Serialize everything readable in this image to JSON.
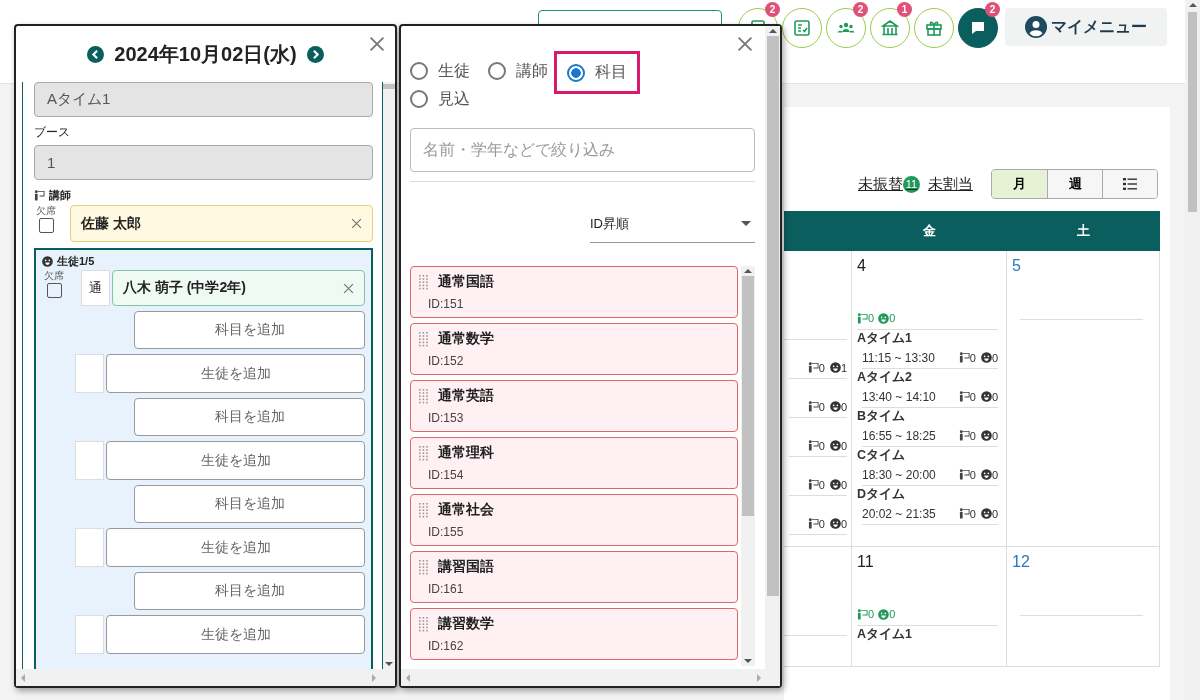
{
  "header": {
    "icon_buttons": [
      {
        "kind": "document",
        "badge": "2"
      },
      {
        "kind": "checklist"
      },
      {
        "kind": "group",
        "badge": "2"
      },
      {
        "kind": "building",
        "badge": "1"
      },
      {
        "kind": "gift"
      },
      {
        "kind": "chat",
        "badge": "2"
      }
    ],
    "my_menu": {
      "label": "マイメニュー"
    }
  },
  "calendar": {
    "links": [
      {
        "label": "未振替",
        "badge": "11"
      },
      {
        "label": "未割当"
      }
    ],
    "views": [
      {
        "kind": "text",
        "label": "月",
        "selected": true
      },
      {
        "kind": "text",
        "label": "週",
        "selected": false
      },
      {
        "kind": "list",
        "selected": false
      }
    ],
    "weekdays": [
      "金",
      "土"
    ],
    "weeks": [
      {
        "partial_slots": [
          {
            "teachers": "0",
            "students": "1"
          },
          {
            "teachers": "0",
            "students": "0"
          },
          {
            "teachers": "0",
            "students": "0"
          },
          {
            "teachers": "0",
            "students": "0"
          },
          {
            "teachers": "0",
            "students": "0"
          }
        ],
        "friday": {
          "day": "4",
          "teachers": "0",
          "students": "0",
          "slots": [
            {
              "name": "Aタイム1",
              "time": "11:15 ~ 13:30",
              "teachers": "0",
              "students": "0"
            },
            {
              "name": "Aタイム2",
              "time": "13:40 ~ 14:10",
              "teachers": "0",
              "students": "0"
            },
            {
              "name": "Bタイム",
              "time": "16:55 ~ 18:25",
              "teachers": "0",
              "students": "0"
            },
            {
              "name": "Cタイム",
              "time": "18:30 ~ 20:00",
              "teachers": "0",
              "students": "0"
            },
            {
              "name": "Dタイム",
              "time": "20:02 ~ 21:35",
              "teachers": "0",
              "students": "0"
            }
          ]
        },
        "saturday": {
          "day": "5"
        }
      },
      {
        "friday": {
          "day": "11",
          "teachers": "0",
          "students": "0",
          "slots": [
            {
              "name": "Aタイム1"
            }
          ]
        },
        "saturday": {
          "day": "12"
        }
      }
    ]
  },
  "lesson_panel": {
    "title": "2024年10月02日(水)",
    "time_field": "Aタイム1",
    "booth_label": "ブース",
    "booth_field": "1",
    "teacher_label": "講師",
    "teacher": {
      "absent_label": "欠席",
      "absent": false,
      "name": "佐藤 太郎"
    },
    "students_label": "生徒1/5",
    "entries": [
      {
        "kind": "student",
        "absent_label": "欠席",
        "absent": false,
        "tag": "通",
        "name": "八木 萌子 (中学2年)"
      },
      {
        "kind": "add-subject",
        "label": "科目を追加"
      },
      {
        "kind": "add-student",
        "label": "生徒を追加"
      },
      {
        "kind": "add-subject",
        "label": "科目を追加"
      },
      {
        "kind": "add-student",
        "label": "生徒を追加"
      },
      {
        "kind": "add-subject",
        "label": "科目を追加"
      },
      {
        "kind": "add-student",
        "label": "生徒を追加"
      },
      {
        "kind": "add-subject",
        "label": "科目を追加"
      },
      {
        "kind": "add-student",
        "label": "生徒を追加"
      }
    ]
  },
  "search_panel": {
    "modes": [
      {
        "label": "生徒",
        "selected": false,
        "highlighted": false
      },
      {
        "label": "講師",
        "selected": false,
        "highlighted": false
      },
      {
        "label": "科目",
        "selected": true,
        "highlighted": true
      },
      {
        "label": "見込",
        "selected": false,
        "highlighted": false
      }
    ],
    "filter": {
      "placeholder": "名前・学年などで絞り込み"
    },
    "sort": {
      "value": "ID昇順"
    },
    "subjects": [
      {
        "name": "通常国語",
        "id": "ID:151"
      },
      {
        "name": "通常数学",
        "id": "ID:152"
      },
      {
        "name": "通常英語",
        "id": "ID:153"
      },
      {
        "name": "通常理科",
        "id": "ID:154"
      },
      {
        "name": "通常社会",
        "id": "ID:155"
      },
      {
        "name": "講習国語",
        "id": "ID:161"
      },
      {
        "name": "講習数学",
        "id": "ID:162"
      }
    ]
  }
}
